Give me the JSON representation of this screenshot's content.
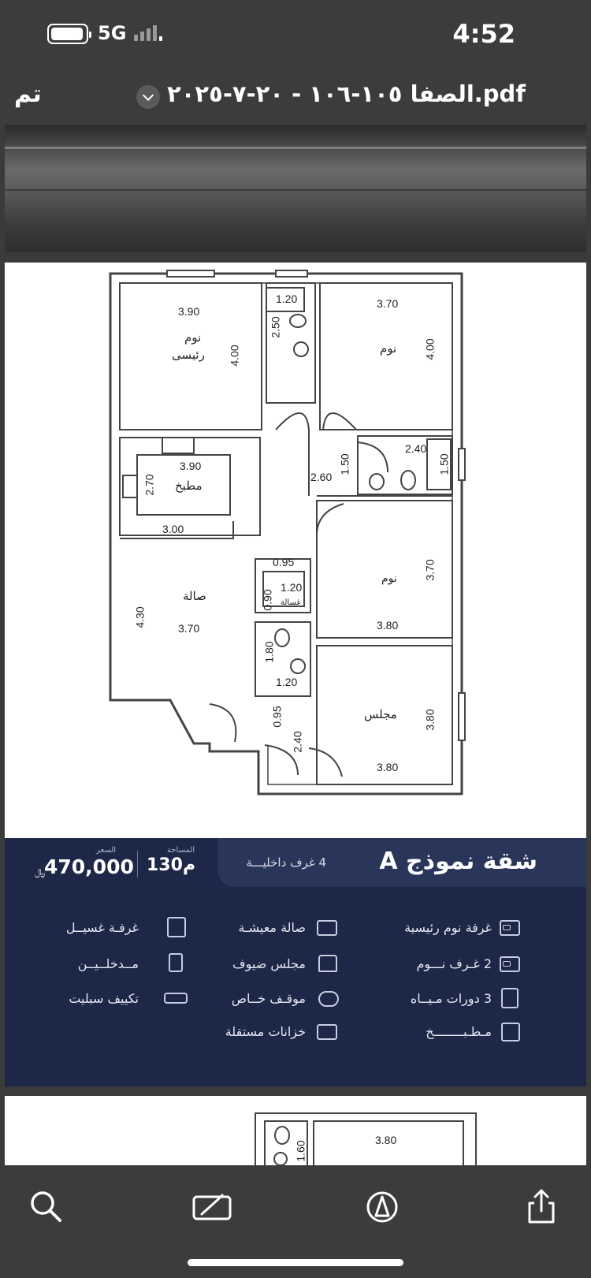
{
  "status_bar": {
    "network": "5G",
    "time": "4:52"
  },
  "title_bar": {
    "done_label": "تم",
    "document_title": "الصفا ١٠٥-١٠٦ - ٢٠-٧-٢٠٢٥.pdf"
  },
  "floor_plan": {
    "labels": {
      "master_bed_w": "3.90",
      "master_bed_h": "4.00",
      "master_bed_name_1": "نوم",
      "master_bed_name_2": "رئيسى",
      "bath_top_w": "1.20",
      "bath_top_h": "2.50",
      "bed_top_right_w": "3.70",
      "bed_top_right_h": "4.00",
      "bed_top_right_name": "نوم",
      "kitchen_w": "3.90",
      "kitchen_h": "2.70",
      "kitchen_name": "مطبخ",
      "kitchen_bottom": "3.00",
      "corridor_w": "2.60",
      "corridor_h": "1.50",
      "bath_right_w": "2.40",
      "bath_right_h": "1.50",
      "hall_name": "صالة",
      "hall_w": "3.70",
      "hall_h": "4.30",
      "laundry_w": "0.95",
      "laundry_inner": "1.20",
      "laundry_h": "0.90",
      "laundry_name": "غسالة",
      "bed_mid_right_w": "3.80",
      "bed_mid_right_h": "3.70",
      "bed_mid_right_name": "نوم",
      "bath_mid_h": "1.80",
      "bath_mid_w": "1.20",
      "entry_w": "0.95",
      "entry_h": "2.40",
      "majlis_name": "مجلس",
      "majlis_w": "3.80",
      "majlis_h": "3.80"
    }
  },
  "listing": {
    "model_title": "شقة نموذج A",
    "rooms_count": "4 غرف داخليـــة",
    "area_label": "المساحة",
    "area_value": "130م",
    "price_label": "السعر",
    "price_value": "470,000",
    "currency": "﷼",
    "features_right": [
      {
        "label": "غرفة نوم رئيسية",
        "icon": "bed-icon"
      },
      {
        "label": "2  غـرف نـــوم",
        "icon": "bed-icon"
      },
      {
        "label": "3  دورات مـيــاه",
        "icon": "bathroom-icon"
      },
      {
        "label": "مـطـبــــــــخ",
        "icon": "kitchen-icon"
      }
    ],
    "features_middle": [
      {
        "label": "صالة معيشـة",
        "icon": "sofa-icon"
      },
      {
        "label": "مجلس ضيوف",
        "icon": "guest-room-icon"
      },
      {
        "label": "موقـف خــاص",
        "icon": "car-icon"
      },
      {
        "label": "خزانات مستقلة",
        "icon": "water-tank-icon"
      }
    ],
    "features_left": [
      {
        "label": "غرفـة غسيــل",
        "icon": "washing-machine-icon"
      },
      {
        "label": "مــدخلــيــن",
        "icon": "door-icon"
      },
      {
        "label": "تكييف سبليت",
        "icon": "air-conditioner-icon"
      }
    ]
  },
  "next_page": {
    "label_1": "3.80",
    "label_2": "1.60"
  }
}
